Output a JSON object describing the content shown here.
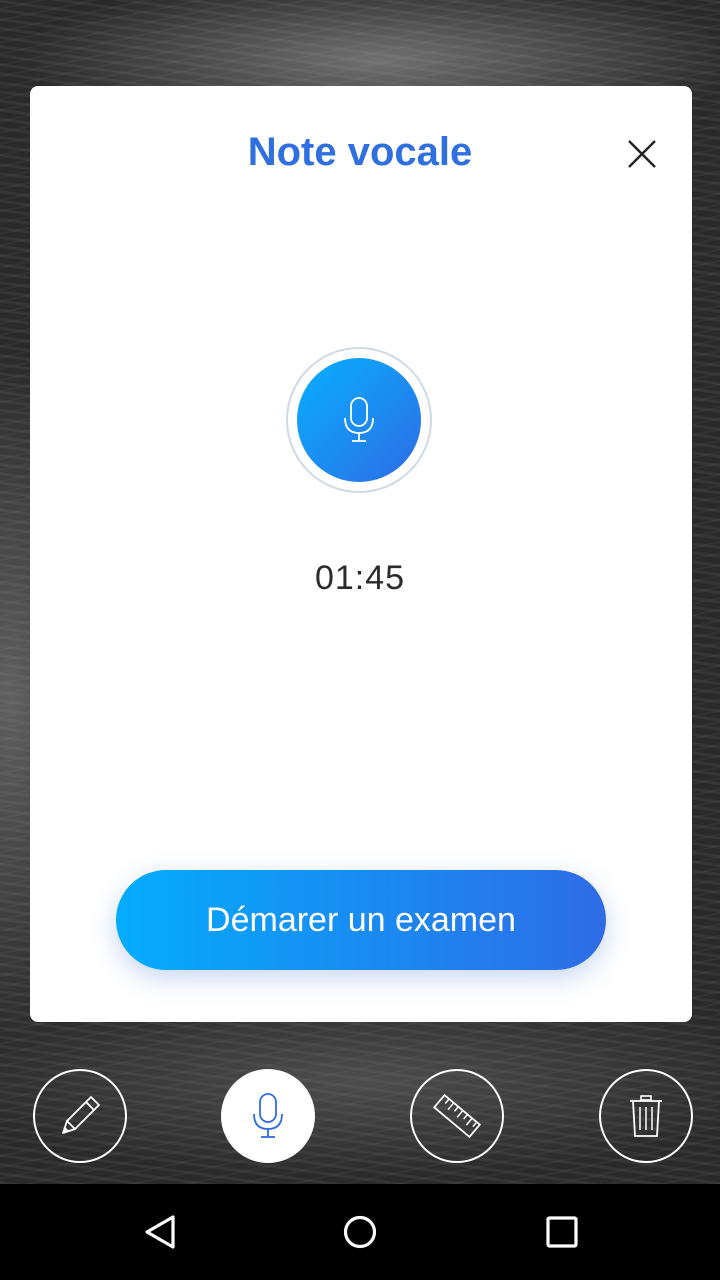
{
  "dialog": {
    "title": "Note vocale",
    "close_icon": "close-icon",
    "mic_icon": "microphone-icon",
    "timer": "01:45",
    "start_button_label": "Démarer un examen"
  },
  "toolbar": {
    "items": [
      {
        "name": "annotate",
        "icon": "pencil-icon",
        "active": false
      },
      {
        "name": "voice-note",
        "icon": "microphone-icon",
        "active": true
      },
      {
        "name": "measure",
        "icon": "ruler-icon",
        "active": false
      },
      {
        "name": "delete",
        "icon": "trash-icon",
        "active": false
      }
    ]
  },
  "system_nav": {
    "back_icon": "back-triangle-icon",
    "home_icon": "home-circle-icon",
    "recents_icon": "recents-square-icon"
  },
  "colors": {
    "accent": "#2f6fe0",
    "gradient_start": "#04acff",
    "gradient_end": "#2e6ce6",
    "timer_text": "#2b2b2b"
  }
}
